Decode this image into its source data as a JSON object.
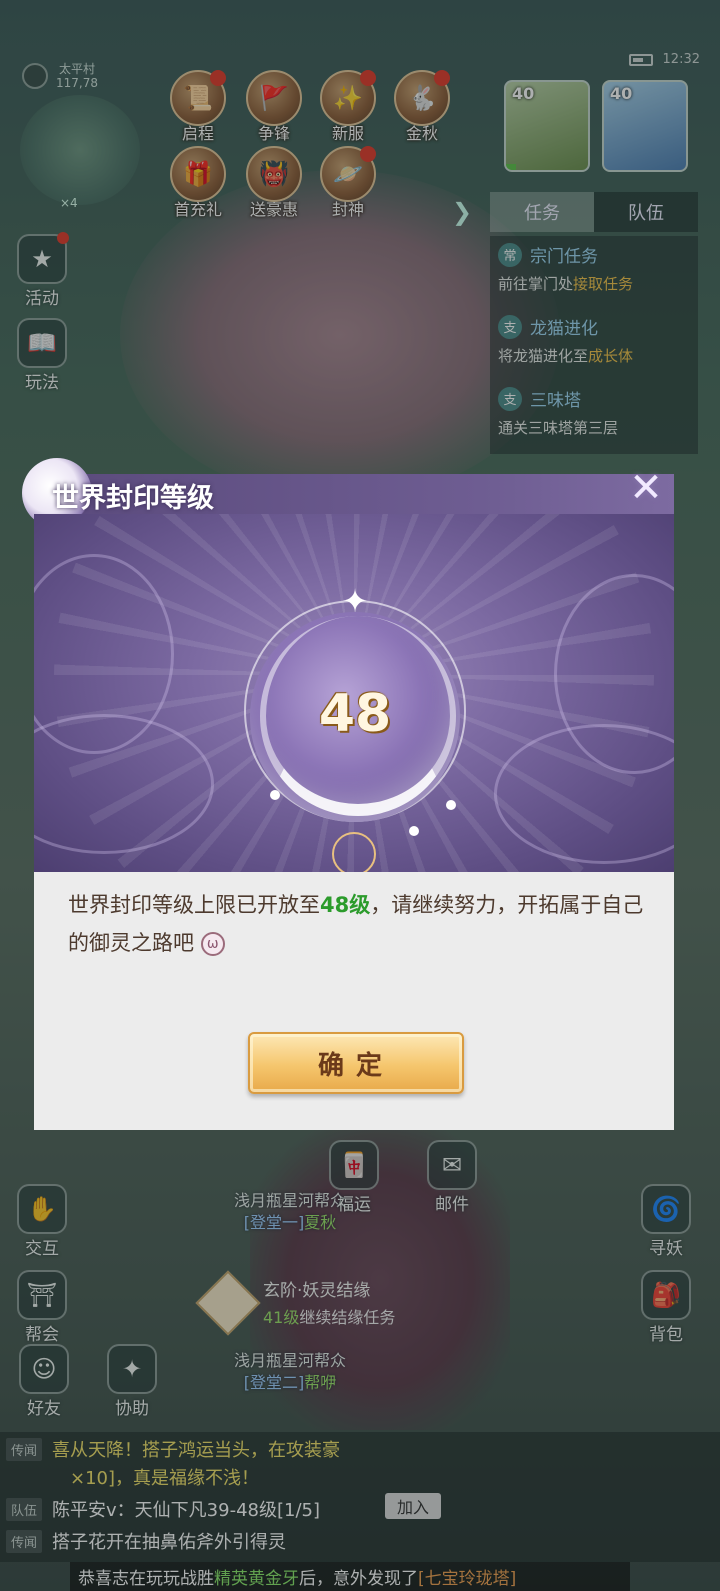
{
  "status": {
    "time": "12:32"
  },
  "location": {
    "name": "太平村",
    "coords": "117,78",
    "lives": "×4"
  },
  "top_icons": [
    {
      "label": "启程",
      "icon": "scroll-icon",
      "glyph": "📜",
      "alert": true
    },
    {
      "label": "争锋",
      "icon": "flag-icon",
      "glyph": "🚩",
      "alert": false
    },
    {
      "label": "新服",
      "icon": "firework-icon",
      "glyph": "✨",
      "alert": true
    },
    {
      "label": "金秋",
      "icon": "rabbit-icon",
      "glyph": "🐇",
      "alert": true
    },
    {
      "label": "首充礼",
      "icon": "gift-icon",
      "glyph": "🎁",
      "alert": false
    },
    {
      "label": "送豪惠",
      "icon": "mask-icon",
      "glyph": "👹",
      "alert": false
    },
    {
      "label": "封神",
      "icon": "planet-icon",
      "glyph": "🪐",
      "alert": true
    }
  ],
  "side_left": [
    {
      "label": "活动",
      "icon": "star-box-icon",
      "glyph": "★",
      "alert": true
    },
    {
      "label": "玩法",
      "icon": "book-icon",
      "glyph": "📖",
      "alert": false
    }
  ],
  "party": [
    {
      "level": "40",
      "color": "#6c8f4e"
    },
    {
      "level": "40",
      "color": "#4e7fb3"
    }
  ],
  "panel_tabs": [
    "任务",
    "队伍"
  ],
  "tasks": [
    {
      "tag": "常",
      "name": "宗门任务",
      "desc_pre": "前往掌门处",
      "desc_hl": "接取任务"
    },
    {
      "tag": "支",
      "name": "龙猫进化",
      "desc_pre": "将龙猫进化至",
      "desc_hl": "成长体"
    },
    {
      "tag": "支",
      "name": "三味塔",
      "desc_pre": "通关三味塔第三层",
      "desc_hl": ""
    }
  ],
  "modal": {
    "title": "世界封印等级",
    "close_icon": "✕",
    "level": "48",
    "message_pre": "世界封印等级上限已开放至",
    "message_num": "48级",
    "message_post": "，请继续努力，开拓属于自己的御灵之路吧",
    "confirm": "确定"
  },
  "lower": {
    "guild1_name": "浅月瓶星河帮众",
    "guild1_sub_pre": "[登堂一]",
    "guild1_sub_name": "夏秋",
    "quest_title": "玄阶·妖灵结缘",
    "quest_level": "41级",
    "quest_desc": "继续结缘任务",
    "guild2_name": "浅月瓶星河帮众",
    "guild2_sub_pre": "[登堂二]",
    "guild2_sub_name": "帮咿",
    "left_bottom": [
      {
        "label": "交互",
        "icon": "handshake-icon",
        "glyph": "✋"
      },
      {
        "label": "帮会",
        "icon": "temple-icon",
        "glyph": "⛩"
      },
      {
        "label": "好友",
        "icon": "friends-icon",
        "glyph": "☺"
      },
      {
        "label": "协助",
        "icon": "assist-icon",
        "glyph": "✦"
      }
    ],
    "right_bottom": [
      {
        "label": "寻妖",
        "icon": "spiral-icon",
        "glyph": "🌀"
      },
      {
        "label": "背包",
        "icon": "bag-icon",
        "glyph": "🎒"
      }
    ],
    "mid_bottom": [
      {
        "label": "福运",
        "icon": "lucky-icon",
        "glyph": "🀄"
      },
      {
        "label": "邮件",
        "icon": "mail-icon",
        "glyph": "✉"
      }
    ]
  },
  "chat": [
    {
      "tag": "传闻",
      "text_pre": "喜从天降！搭子鸿运当头，在攻装豪",
      "text_y": "",
      "text_post": ""
    },
    {
      "tag": "",
      "text_pre": "×10]，真是福缘不浅！",
      "text_y": "",
      "text_post": ""
    },
    {
      "tag": "队伍",
      "text_pre": "陈平安v：天仙下凡39-48级[1/5]",
      "text_y": "",
      "text_post": ""
    },
    {
      "tag": "传闻",
      "text_pre": "搭子花开在抽鼻佑斧外引得灵",
      "text_y": "",
      "text_post": ""
    }
  ],
  "join_label": "加入",
  "marquee": {
    "pre": "恭喜志在玩玩战胜",
    "green": "精英黄金牙",
    "mid": "后，意外发现了",
    "item": "[七宝玲珑塔]"
  }
}
